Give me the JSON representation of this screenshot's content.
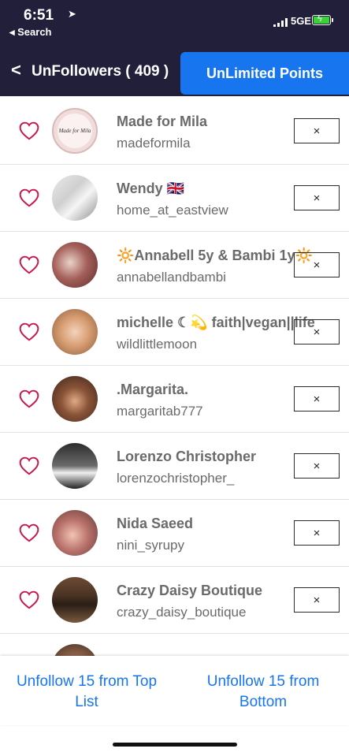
{
  "status_bar": {
    "time": "6:51",
    "back_app": "◂ Search",
    "network": "5GE"
  },
  "header": {
    "back_icon": "chevron-left-icon",
    "title": "UnFollowers ( 409 )",
    "points_button": "UnLimited Points"
  },
  "colors": {
    "header_bg": "#211f3a",
    "accent": "#1775f0",
    "heart": "#c8164e",
    "text": "#6a6a6a"
  },
  "list": {
    "remove_label": "×",
    "rows": [
      {
        "name": "Made for Mila",
        "handle": "madeformila"
      },
      {
        "name": "Wendy 🇬🇧",
        "handle": "home_at_eastview"
      },
      {
        "name": "🔆Annabell 5y & Bambi 1y🔆",
        "handle": "annabellandbambi"
      },
      {
        "name": "michelle ☾💫 faith|vegan||life",
        "handle": "wildlittlemoon"
      },
      {
        "name": ".Margarita.",
        "handle": "margaritab777"
      },
      {
        "name": "Lorenzo Christopher",
        "handle": "lorenzochristopher_"
      },
      {
        "name": "Nida Saeed",
        "handle": "nini_syrupy"
      },
      {
        "name": "Crazy Daisy Boutique",
        "handle": "crazy_daisy_boutique"
      },
      {
        "name": "",
        "handle": ""
      }
    ]
  },
  "bottom": {
    "left_label": "Unfollow 15 from Top List",
    "right_label": "Unfollow 15 from Bottom"
  }
}
